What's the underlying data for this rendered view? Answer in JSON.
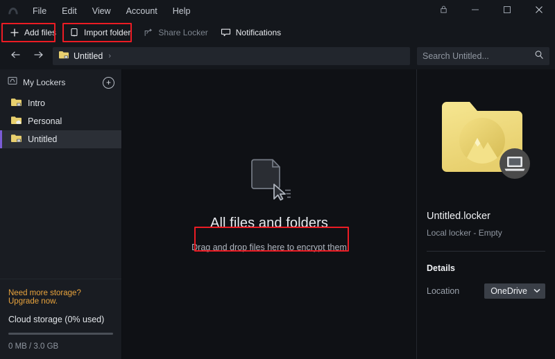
{
  "titlebar": {
    "app_logo_icon": "nordlocker-mountain-logo",
    "menu": [
      {
        "label": "File"
      },
      {
        "label": "Edit"
      },
      {
        "label": "View"
      },
      {
        "label": "Account"
      },
      {
        "label": "Help"
      }
    ],
    "window_controls": [
      {
        "name": "lock-button",
        "icon": "lock-icon"
      },
      {
        "name": "minimize-button",
        "icon": "minimize-icon"
      },
      {
        "name": "maximize-button",
        "icon": "maximize-icon"
      },
      {
        "name": "close-button",
        "icon": "close-icon"
      }
    ]
  },
  "toolbar": {
    "add_files_label": "Add files",
    "add_files_icon": "plus-icon",
    "import_folder_label": "Import folder",
    "import_folder_icon": "import-folder-icon",
    "share_locker_label": "Share Locker",
    "share_locker_icon": "share-icon",
    "notifications_label": "Notifications",
    "notifications_icon": "speech-bubble-icon"
  },
  "navbar": {
    "back_icon": "arrow-left-icon",
    "forward_icon": "arrow-right-icon",
    "breadcrumb": {
      "folder_icon": "locker-folder-icon",
      "label": "Untitled",
      "separator": "›"
    }
  },
  "search": {
    "placeholder": "Search Untitled...",
    "value": "",
    "icon": "search-icon"
  },
  "sidebar": {
    "section_title": "My Lockers",
    "section_icon": "lockers-icon",
    "add_button_icon": "plus-circle-icon",
    "items": [
      {
        "label": "Intro",
        "icon": "local-locker-folder-icon",
        "selected": false
      },
      {
        "label": "Personal",
        "icon": "cloud-locker-folder-icon",
        "selected": false
      },
      {
        "label": "Untitled",
        "icon": "local-locker-folder-icon",
        "selected": true
      }
    ],
    "storage": {
      "upgrade_text": "Need more storage? Upgrade now.",
      "cloud_label": "Cloud storage (0% used)",
      "used_percent": 0,
      "usage_text": "0 MB / 3.0 GB"
    }
  },
  "main": {
    "empty_icon": "document-drag-icon",
    "title": "All files and folders",
    "subtitle": "Drag and drop files here to encrypt them"
  },
  "rightpanel": {
    "preview_icon": "locker-folder-large-icon",
    "badge_icon": "laptop-icon",
    "locker_name": "Untitled.locker",
    "locker_state": "Local locker - Empty",
    "details_title": "Details",
    "location_label": "Location",
    "location_value": "OneDrive",
    "location_chevron": "chevron-down-icon"
  },
  "colors": {
    "accent_purple": "#7b5cd6",
    "folder_yellow": "#f0de84",
    "upgrade_orange": "#e8a33d",
    "highlight_red": "#ec1c24",
    "window_bg": "#0f1115",
    "chrome_bg": "#14171c",
    "sidebar_bg": "#191c22"
  },
  "highlights": [
    {
      "name": "add-files-highlight"
    },
    {
      "name": "import-folder-highlight"
    },
    {
      "name": "drag-drop-hint-highlight"
    }
  ]
}
